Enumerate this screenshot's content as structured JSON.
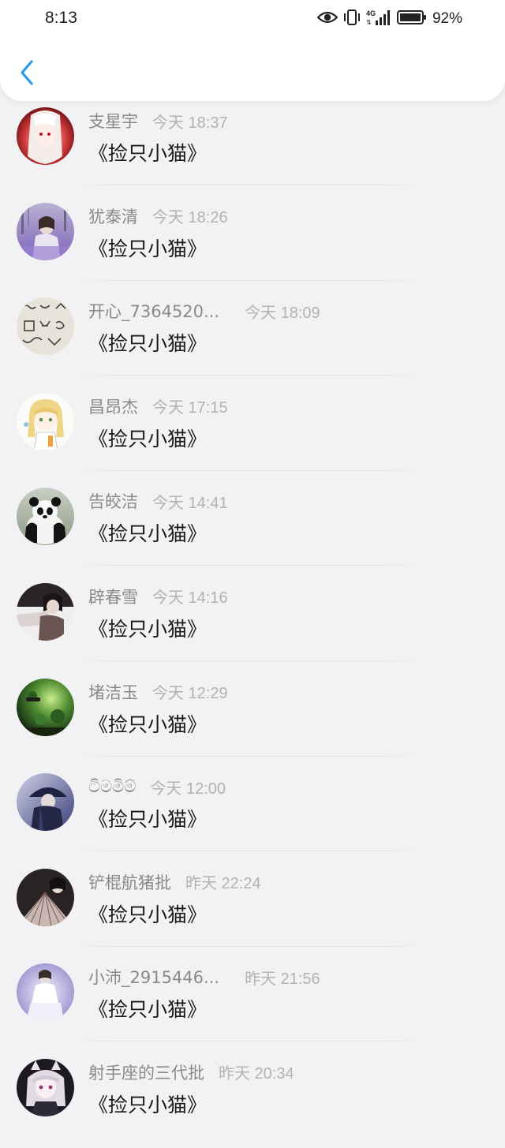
{
  "status_bar": {
    "time": "8:13",
    "battery": "92%",
    "network": "4G",
    "icons": [
      "eye-icon",
      "vibrate-icon",
      "signal-4g-icon",
      "battery-icon"
    ]
  },
  "nav": {
    "back_icon": "chevron-left-icon",
    "accent_color": "#2a9cf0"
  },
  "list": {
    "items": [
      {
        "name": "支星宇",
        "time": "今天 18:37",
        "title": "《捡只小猫》",
        "avatar": "anime-girl-red-eyes"
      },
      {
        "name": "犹泰清",
        "time": "今天 18:26",
        "title": "《捡只小猫》",
        "avatar": "girl-lavender-field"
      },
      {
        "name": "开心_7364520...",
        "time": "今天 18:09",
        "title": "《捡只小猫》",
        "avatar": "calligraphy-pattern"
      },
      {
        "name": "昌昂杰",
        "time": "今天 17:15",
        "title": "《捡只小猫》",
        "avatar": "blonde-chibi-girl"
      },
      {
        "name": "告皎洁",
        "time": "今天 14:41",
        "title": "《捡只小猫》",
        "avatar": "panda"
      },
      {
        "name": "辟春雪",
        "time": "今天 14:16",
        "title": "《捡只小猫》",
        "avatar": "dark-portrait"
      },
      {
        "name": "堵洁玉",
        "time": "今天 12:29",
        "title": "《捡只小猫》",
        "avatar": "green-forest"
      },
      {
        "name": "ටිමමිම්",
        "time": "今天 12:00",
        "title": "《捡只小猫》",
        "avatar": "dark-hat-figure"
      },
      {
        "name": "铲棍航猪批",
        "time": "昨天 22:24",
        "title": "《捡只小猫》",
        "avatar": "fan-girl"
      },
      {
        "name": "小沛_2915446...",
        "time": "昨天 21:56",
        "title": "《捡只小猫》",
        "avatar": "white-dress-girl"
      },
      {
        "name": "射手座的三代批",
        "time": "昨天 20:34",
        "title": "《捡只小猫》",
        "avatar": "anime-cat-ear-girl"
      }
    ]
  }
}
